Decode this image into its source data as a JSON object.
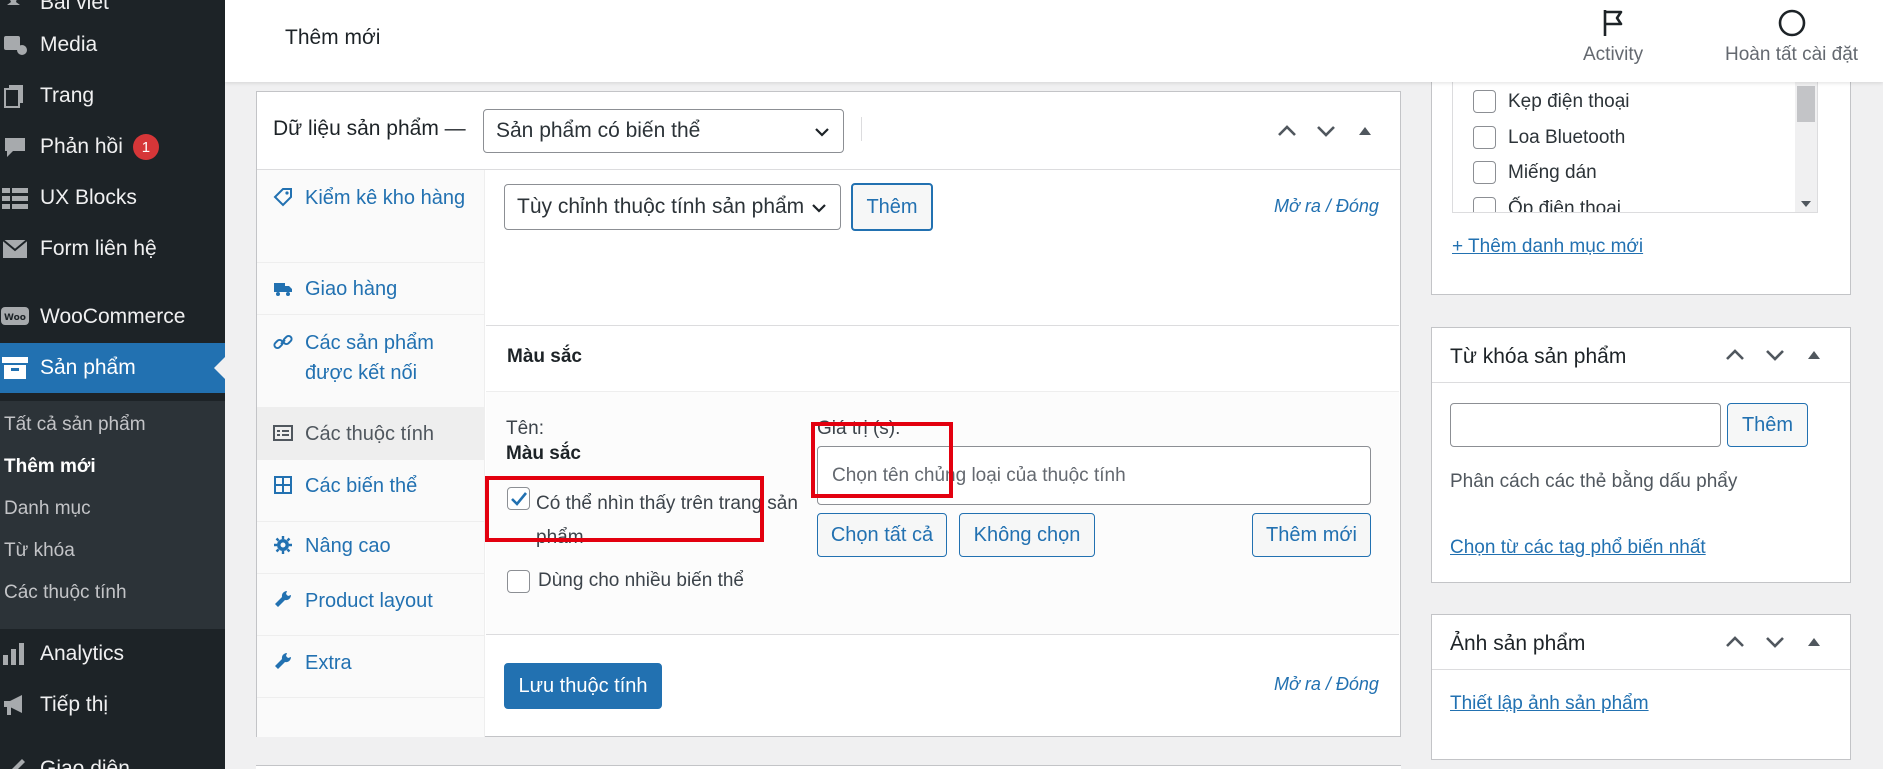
{
  "sidebar": {
    "items": [
      {
        "label": "Bài viết",
        "icon": "pin-icon"
      },
      {
        "label": "Media",
        "icon": "media-icon"
      },
      {
        "label": "Trang",
        "icon": "pages-icon"
      },
      {
        "label": "Phản hồi",
        "icon": "comments-icon",
        "badge": "1"
      },
      {
        "label": "UX Blocks",
        "icon": "blocks-icon"
      },
      {
        "label": "Form liên hệ",
        "icon": "mail-icon"
      },
      {
        "label": "WooCommerce",
        "icon": "woo-icon"
      },
      {
        "label": "Sản phẩm",
        "icon": "archive-icon"
      },
      {
        "label": "Analytics",
        "icon": "chart-icon"
      },
      {
        "label": "Tiếp thị",
        "icon": "megaphone-icon"
      },
      {
        "label": "Giao diện",
        "icon": "brush-icon"
      }
    ],
    "submenu": [
      "Tất cả sản phẩm",
      "Thêm mới",
      "Danh mục",
      "Từ khóa",
      "Các thuộc tính"
    ]
  },
  "topbar": {
    "title": "Thêm mới",
    "activity_label": "Activity",
    "setup_label": "Hoàn tất cài đặt"
  },
  "product_data": {
    "title": "Dữ liệu sản phẩm —",
    "type_select": "Sản phẩm có biến thể",
    "tabs": [
      "Kiểm kê kho hàng",
      "Giao hàng",
      "Các sản phẩm được kết nối",
      "Các thuộc tính",
      "Các biến thể",
      "Nâng cao",
      "Product layout",
      "Extra"
    ],
    "attr_select": "Tùy chỉnh thuộc tính sản phẩm",
    "add_button": "Thêm",
    "expand_close": "Mở ra / Đóng",
    "attribute": {
      "heading": "Màu sắc",
      "name_label": "Tên:",
      "name_value": "Màu sắc",
      "visible_label": "Có thể nhìn thấy trên trang sản phẩm",
      "variation_label": "Dùng cho nhiều biến thể",
      "values_label": "Giá trị (s):",
      "values_placeholder": "Chọn tên chủng loại của thuộc tính",
      "select_all": "Chọn tất cả",
      "select_none": "Không chọn",
      "add_new": "Thêm mới"
    },
    "save_button": "Lưu thuộc tính"
  },
  "categories": {
    "items": [
      "Kẹp điện thoại",
      "Loa Bluetooth",
      "Miếng dán",
      "Ốp điện thoại"
    ],
    "add_link": "+ Thêm danh mục mới"
  },
  "tags": {
    "title": "Từ khóa sản phẩm",
    "add_button": "Thêm",
    "hint": "Phân cách các thẻ bằng dấu phẩy",
    "popular_link": "Chọn từ các tag phổ biến nhất"
  },
  "product_image": {
    "title": "Ảnh sản phẩm",
    "set_link": "Thiết lập ảnh sản phẩm"
  }
}
